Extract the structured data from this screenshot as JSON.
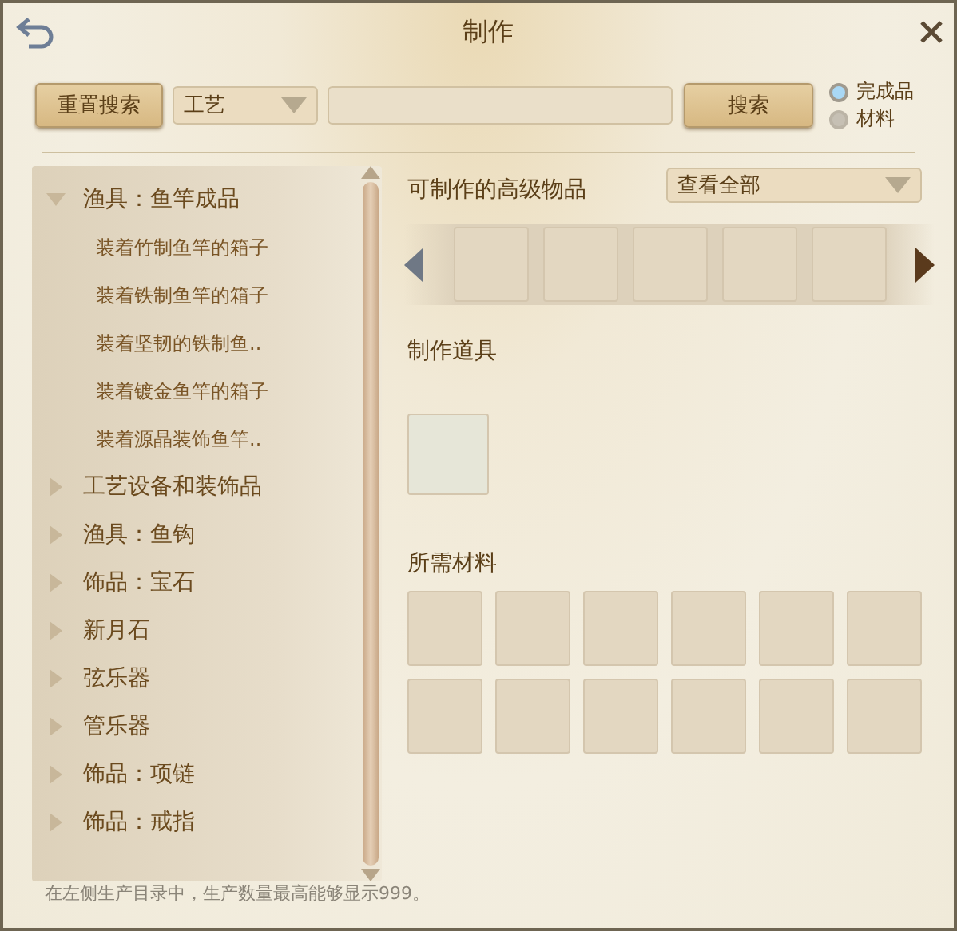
{
  "window": {
    "title": "制作"
  },
  "toolbar": {
    "reset_button": "重置搜索",
    "category_dropdown": {
      "value": "工艺"
    },
    "search_button": "搜索",
    "radios": [
      {
        "label": "完成品",
        "selected": true
      },
      {
        "label": "材料",
        "selected": false
      }
    ]
  },
  "tree": [
    {
      "label": "渔具：鱼竿成品",
      "expanded": true,
      "children": [
        {
          "label": "装着竹制鱼竿的箱子"
        },
        {
          "label": "装着铁制鱼竿的箱子"
        },
        {
          "label": "装着坚韧的铁制鱼.."
        },
        {
          "label": "装着镀金鱼竿的箱子"
        },
        {
          "label": "装着源晶装饰鱼竿.."
        }
      ]
    },
    {
      "label": "工艺设备和装饰品",
      "expanded": false
    },
    {
      "label": "渔具：鱼钩",
      "expanded": false
    },
    {
      "label": "饰品：宝石",
      "expanded": false
    },
    {
      "label": "新月石",
      "expanded": false
    },
    {
      "label": "弦乐器",
      "expanded": false
    },
    {
      "label": "管乐器",
      "expanded": false
    },
    {
      "label": "饰品：项链",
      "expanded": false
    },
    {
      "label": "饰品：戒指",
      "expanded": false
    }
  ],
  "advanced_items": {
    "title": "可制作的高级物品",
    "filter_dropdown": {
      "value": "查看全部"
    }
  },
  "crafting_tool": {
    "title": "制作道具"
  },
  "materials": {
    "title": "所需材料"
  },
  "footer": "在左侧生产目录中，生产数量最高能够显示999。"
}
